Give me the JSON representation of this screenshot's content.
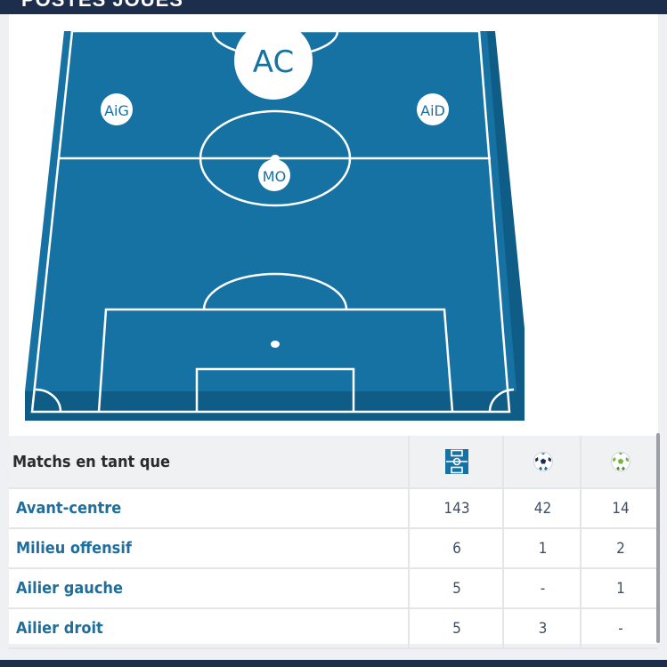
{
  "section_title": "POSTES JOUÉS",
  "pitch": {
    "colors": {
      "field": "#1672a3",
      "side": "#0f5d87",
      "lines": "#ffffff"
    },
    "positions": {
      "ac": "AC",
      "aig": "AiG",
      "aid": "AiD",
      "mo": "MO"
    }
  },
  "table": {
    "header": {
      "label": "Matchs en tant que",
      "icons": [
        "pitch-icon",
        "ball-icon",
        "assist-ball-icon"
      ]
    },
    "rows": [
      {
        "position": "Avant-centre",
        "matches": "143",
        "goals": "42",
        "assists": "14"
      },
      {
        "position": "Milieu offensif",
        "matches": "6",
        "goals": "1",
        "assists": "2"
      },
      {
        "position": "Ailier gauche",
        "matches": "5",
        "goals": "-",
        "assists": "1"
      },
      {
        "position": "Ailier droit",
        "matches": "5",
        "goals": "3",
        "assists": "-"
      }
    ]
  },
  "colors": {
    "header_bg": "#1d2d4c",
    "link": "#1f6e9c"
  }
}
